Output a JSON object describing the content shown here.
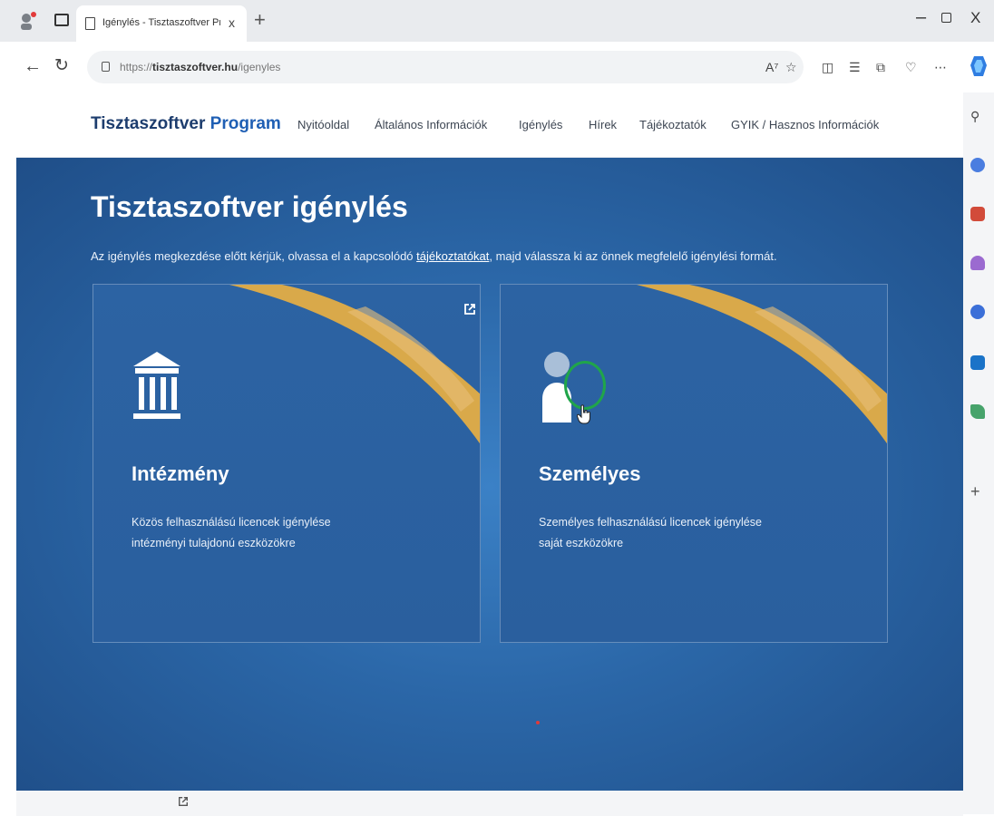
{
  "browser": {
    "tab_title": "Igénylés - Tisztaszoftver Program",
    "tab_close": "x",
    "new_tab": "+",
    "url_prefix": "https://",
    "url_domain": "tisztaszoftver.hu",
    "url_path": "/igenyles",
    "window_min": "–",
    "window_close": "X"
  },
  "site": {
    "brand_main": "Tisztaszoftver ",
    "brand_accent": "Program",
    "nav": [
      {
        "label": "Nyitóoldal"
      },
      {
        "label": "Általános Információk"
      },
      {
        "label": "Igénylés"
      },
      {
        "label": "Hírek"
      },
      {
        "label": "Tájékoztatók"
      },
      {
        "label": "GYIK / Hasznos Információk"
      }
    ]
  },
  "hero": {
    "title": "Tisztaszoftver igénylés",
    "intro_before": "Az igénylés megkezdése előtt kérjük, olvassa el a kapcsolódó ",
    "intro_link": "tájékoztatókat",
    "intro_after": ", majd válassza ki az önnek megfelelő igénylési formát."
  },
  "cards": [
    {
      "title": "Intézmény",
      "desc_line1": "Közös felhasználású licencek igénylése",
      "desc_line2": "intézményi tulajdonú eszközökre",
      "icon": "institution-building-icon"
    },
    {
      "title": "Személyes",
      "desc_line1": "Személyes felhasználású licencek igénylése",
      "desc_line2": "saját eszközökre",
      "icon": "person-icon"
    }
  ],
  "colors": {
    "hero_blue": "#2b67a8",
    "brand_navy": "#1d3d6e",
    "gold_swoosh": "#d9a94a",
    "highlight_green": "#20a54a"
  }
}
